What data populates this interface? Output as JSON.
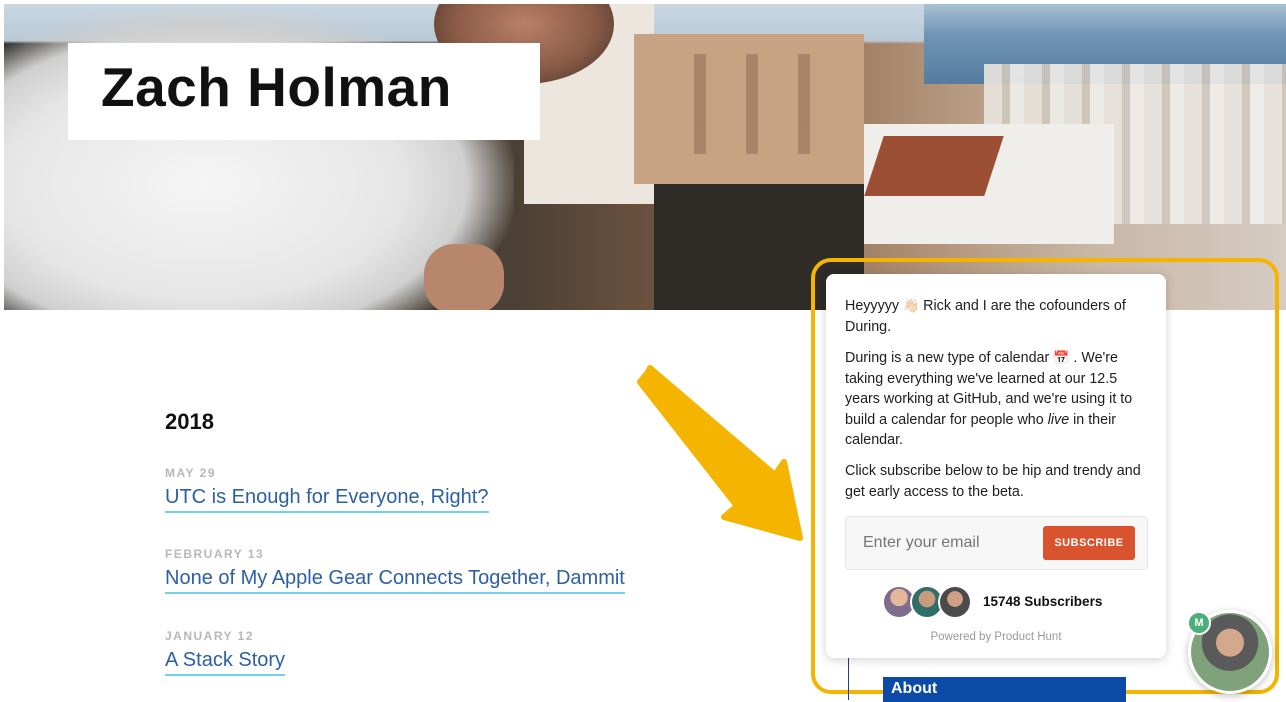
{
  "header": {
    "site_title": "Zach Holman"
  },
  "archive": {
    "year": "2018",
    "posts": [
      {
        "date": "MAY 29",
        "title": "UTC is Enough for Everyone, Right?"
      },
      {
        "date": "FEBRUARY 13",
        "title": "None of My Apple Gear Connects Together, Dammit"
      },
      {
        "date": "JANUARY 12",
        "title": "A Stack Story"
      }
    ]
  },
  "popup": {
    "p1_a": "Heyyyyy",
    "p1_emoji": "👋🏻",
    "p1_b": " Rick and I are the cofounders of During.",
    "p2_a": "During is a new type of calendar",
    "p2_emoji": "📅",
    "p2_b": ". We're taking everything we've learned at our 12.5 years working at GitHub, and we're using it to build a calendar for people who ",
    "p2_em": "live",
    "p2_c": " in their calendar.",
    "p3": "Click subscribe below to be hip and trendy and get early access to the beta.",
    "email_placeholder": "Enter your email",
    "subscribe_label": "SUBSCRIBE",
    "subscriber_count": "15748 Subscribers",
    "powered_by": "Powered by Product Hunt"
  },
  "sidebar": {
    "about_label": "About"
  },
  "chat": {
    "badge": "M"
  },
  "colors": {
    "highlight": "#f4b400",
    "subscribe": "#d9532f",
    "link": "#2d5fa6",
    "underline": "#6fd3ec",
    "about_bg": "#0b4aa6"
  }
}
